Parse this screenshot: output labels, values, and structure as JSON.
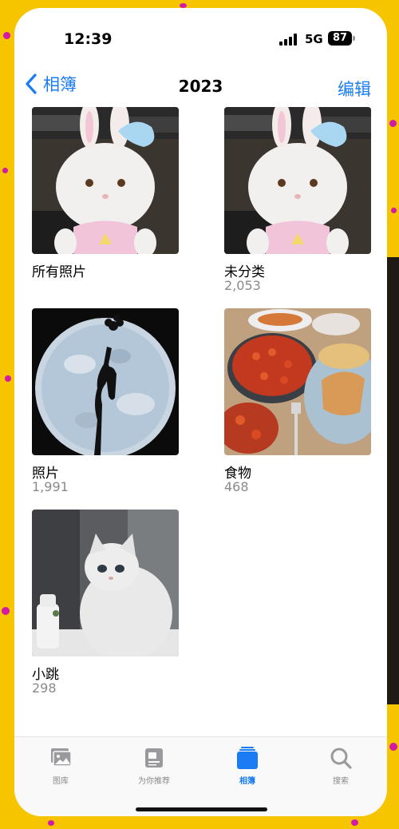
{
  "status_bar": {
    "time": "12:39",
    "network": "5G",
    "battery": "87"
  },
  "nav": {
    "back_label": "相簿",
    "title": "2023",
    "edit_label": "编辑"
  },
  "albums": [
    {
      "name": "所有照片",
      "count": ""
    },
    {
      "name": "未分类",
      "count": "2,053"
    },
    {
      "name": "照片",
      "count": "1,991"
    },
    {
      "name": "食物",
      "count": "468"
    },
    {
      "name": "小跳",
      "count": "298"
    }
  ],
  "tabs": [
    {
      "label": "图库",
      "icon": "photo-library-icon"
    },
    {
      "label": "为你推荐",
      "icon": "for-you-icon"
    },
    {
      "label": "相簿",
      "icon": "albums-icon"
    },
    {
      "label": "搜索",
      "icon": "search-icon"
    }
  ],
  "colors": {
    "accent": "#1a7cf2",
    "background_frame": "#f7c400",
    "dots": "#d21aa6",
    "secondary_text": "#8a8a8e"
  }
}
